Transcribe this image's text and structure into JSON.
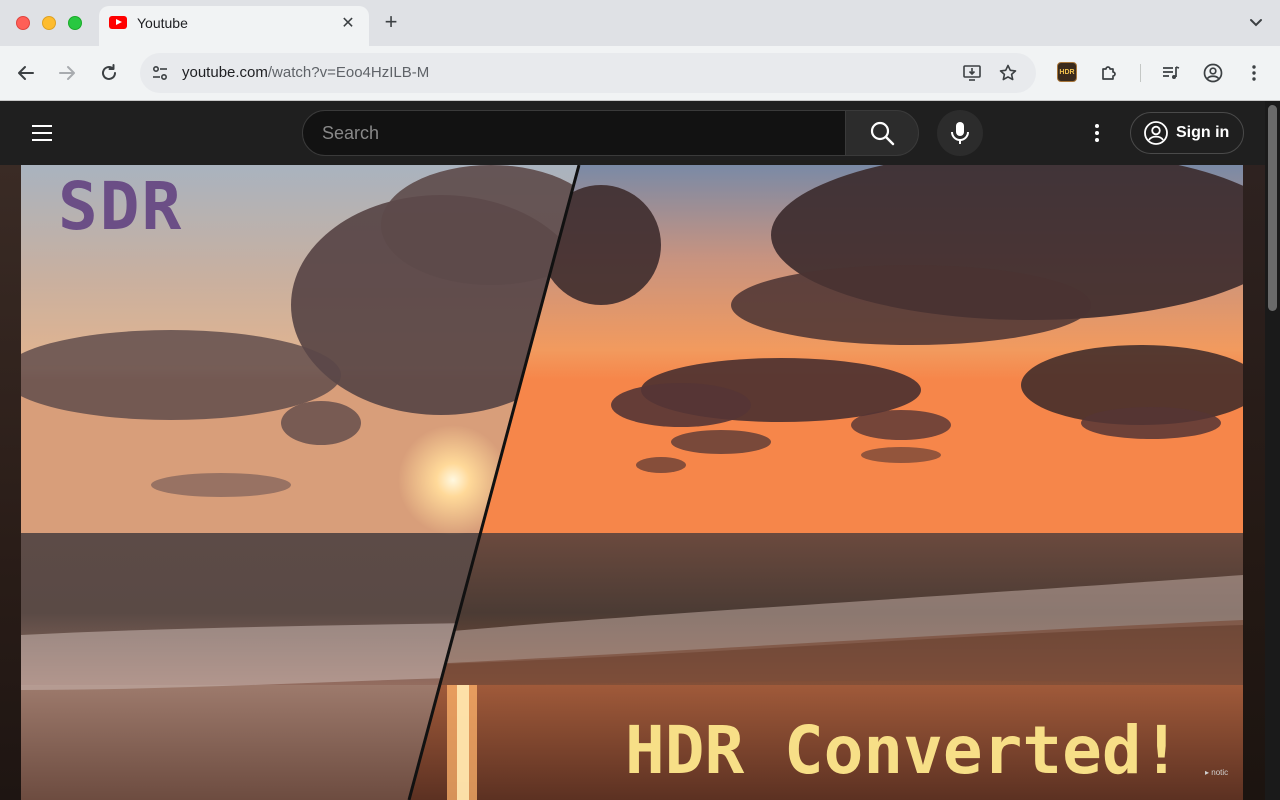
{
  "browser": {
    "tab": {
      "title": "Youtube"
    },
    "address": {
      "host": "youtube.com",
      "path": "/watch?v=Eoo4HzILB-M"
    },
    "extension_badge": "HDR"
  },
  "youtube": {
    "search": {
      "placeholder": "Search"
    },
    "signin_label": "Sign in"
  },
  "video": {
    "left_label": "SDR",
    "right_label": "HDR Converted!",
    "corner_badge": "▸ notic"
  },
  "colors": {
    "sdr_label": "#6b4e86",
    "hdr_label": "#f7df87",
    "youtube_red": "#ff0000"
  },
  "icons": [
    "youtube-favicon",
    "close-icon",
    "plus-icon",
    "chevron-down-icon",
    "back-arrow-icon",
    "forward-arrow-icon",
    "reload-icon",
    "site-settings-icon",
    "install-app-icon",
    "star-icon",
    "hdr-extension-icon",
    "puzzle-icon",
    "media-controls-icon",
    "profile-icon",
    "more-vert-icon",
    "hamburger-icon",
    "search-icon",
    "mic-icon",
    "account-icon"
  ]
}
